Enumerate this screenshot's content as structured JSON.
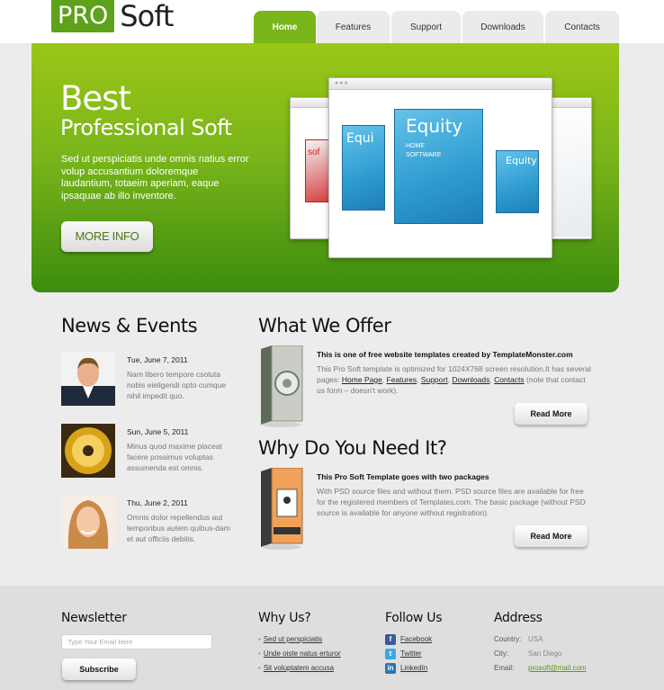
{
  "brand": {
    "pro": "PRO",
    "soft": "Soft",
    "accent": "#7ab51a"
  },
  "nav": [
    {
      "label": "Home",
      "active": true
    },
    {
      "label": "Features",
      "active": false
    },
    {
      "label": "Support",
      "active": false
    },
    {
      "label": "Downloads",
      "active": false
    },
    {
      "label": "Contacts",
      "active": false
    }
  ],
  "hero": {
    "title": "Best",
    "subtitle": "Professional Soft",
    "text": "Sed ut perspiciatis unde omnis natius error volup accusantium doloremque laudantium, totaeim aperiam, eaque ipsaquae ab illo inventore.",
    "button": "MORE INFO",
    "box_title": "Equity",
    "box_sub1": "HOME",
    "box_sub2": "SOFTWARE",
    "side_box_label": "sof"
  },
  "news": {
    "title": "News & Events",
    "items": [
      {
        "date": "Tue, June 7, 2011",
        "text": "Nam libero tempore csoluta nobis eieligendi opto cumque nihil impedit quo."
      },
      {
        "date": "Sun, June 5, 2011",
        "text": "Minus quod maxime placeat facere possimus voluptas assumenda est omnis."
      },
      {
        "date": "Thu, June 2, 2011",
        "text": "Omnis dolor repellendus aut temporibus autem quibus-dam et aut officiis debitis."
      }
    ]
  },
  "offer": {
    "title": "What We Offer",
    "item_title": "This is one of free website templates created by TemplateMonster.com",
    "text_before": "This Pro Soft template is optimized for 1024X768 screen resolution.It has several pages:",
    "links": [
      "Home Page",
      "Features",
      "Support",
      "Downloads",
      "Contacts"
    ],
    "text_after": "(note that contact us form – doesn't work).",
    "button": "Read More"
  },
  "why": {
    "title": "Why Do You Need It?",
    "item_title": "This Pro Soft Template goes with two packages",
    "text": "With PSD source files and without them. PSD source files are available for free for the registered members of Templates.com. The basic package (without PSD source is available for anyone without registration).",
    "button": "Read More",
    "box_label": "SOFTWARE"
  },
  "footer": {
    "newsletter": {
      "title": "Newsletter",
      "placeholder": "Type Your Email Here",
      "button": "Subscribe"
    },
    "why_us": {
      "title": "Why Us?",
      "links": [
        "Sed ut perspiciatis",
        "Unde oiste natus erturor",
        "Sit voluptatem accusa"
      ]
    },
    "follow": {
      "title": "Follow Us",
      "items": [
        {
          "label": "Facebook",
          "icon": "facebook-icon",
          "color": "#3b5998"
        },
        {
          "label": "Twitter",
          "icon": "twitter-icon",
          "color": "#39a9e0"
        },
        {
          "label": "LinkedIn",
          "icon": "linkedin-icon",
          "color": "#2a75b3"
        }
      ]
    },
    "address": {
      "title": "Address",
      "rows": [
        {
          "key": "Country:",
          "value": "USA"
        },
        {
          "key": "City:",
          "value": "San Diego"
        },
        {
          "key": "Email:",
          "value": "prosoft@mail.com"
        }
      ]
    }
  }
}
